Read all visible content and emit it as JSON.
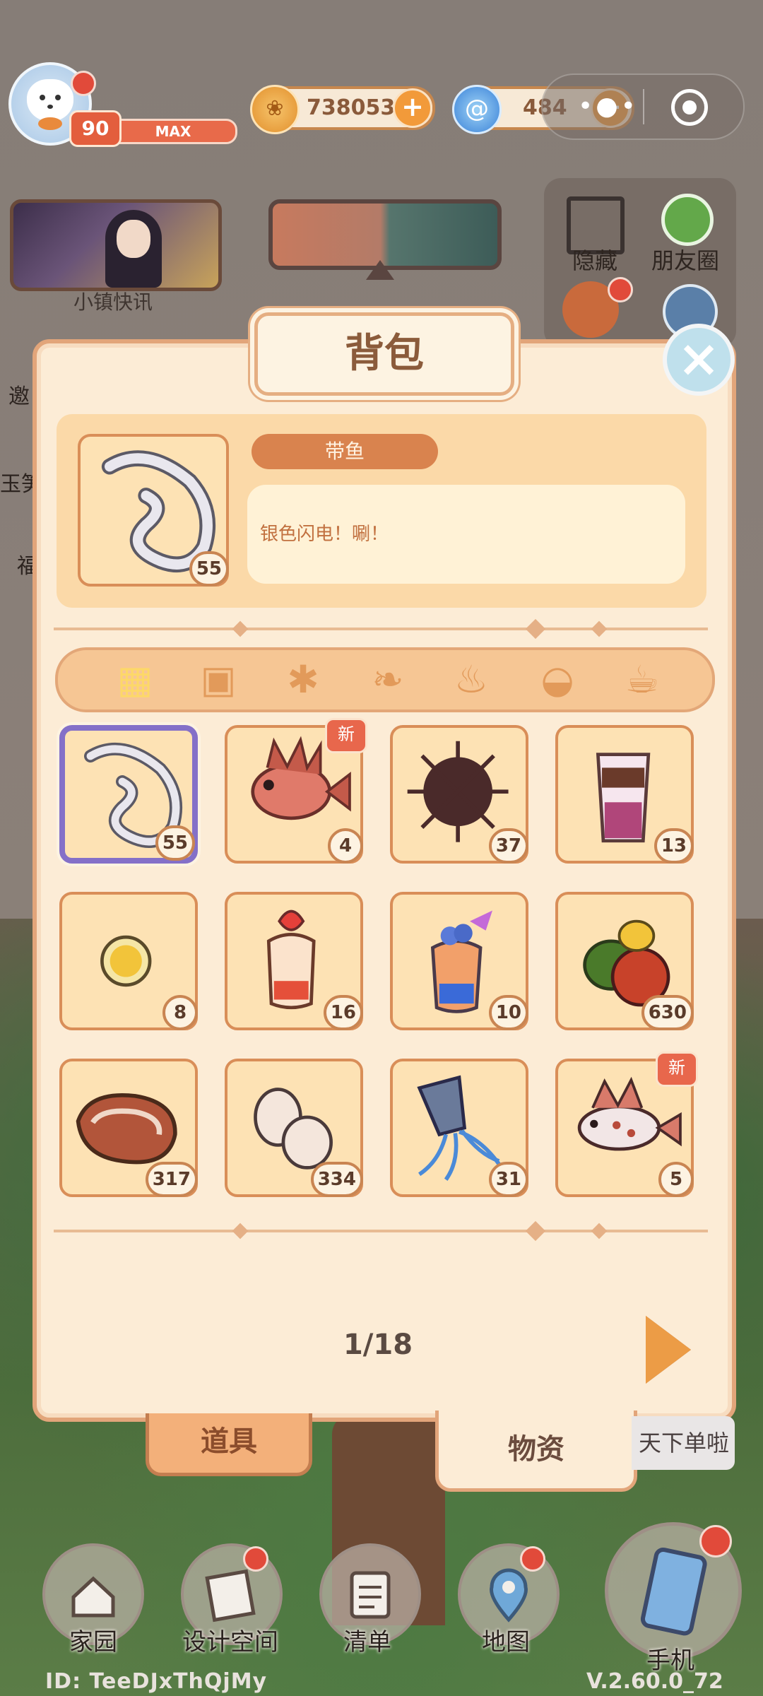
{
  "top_bar": {
    "level": "90",
    "level_status": "MAX",
    "coins": "738053",
    "gems": "484",
    "coin_plus": "+",
    "gem_plus": "+"
  },
  "hud": {
    "news_label": "小镇快讯",
    "hide_label": "隐藏",
    "friends_label": "朋友圈",
    "left_cut_1": "邀",
    "left_cut_2": "玉笋",
    "left_cut_3": "福"
  },
  "backpack": {
    "title": "背包",
    "close": "×",
    "selected_item": {
      "name": "带鱼",
      "description": "银色闪电！唰！",
      "count": "55"
    },
    "categories": [
      {
        "name": "all",
        "icon": "grid-icon"
      },
      {
        "name": "seeds",
        "icon": "seed-packet-icon"
      },
      {
        "name": "plants",
        "icon": "plant-icon"
      },
      {
        "name": "fish",
        "icon": "fish-icon"
      },
      {
        "name": "meat",
        "icon": "drumstick-icon"
      },
      {
        "name": "food",
        "icon": "bowl-icon"
      },
      {
        "name": "drinks",
        "icon": "cup-icon"
      }
    ],
    "new_tag": "新",
    "items": [
      {
        "count": "55",
        "icon": "hairtail-fish-icon",
        "is_new": false,
        "selected": true
      },
      {
        "count": "4",
        "icon": "red-scorpionfish-icon",
        "is_new": true,
        "selected": false
      },
      {
        "count": "37",
        "icon": "sea-urchin-icon",
        "is_new": false,
        "selected": false
      },
      {
        "count": "13",
        "icon": "layered-drink-icon",
        "is_new": false,
        "selected": false
      },
      {
        "count": "8",
        "icon": "lemon-slice-icon",
        "is_new": false,
        "selected": false
      },
      {
        "count": "16",
        "icon": "strawberry-parfait-icon",
        "is_new": false,
        "selected": false
      },
      {
        "count": "10",
        "icon": "blueberry-drink-icon",
        "is_new": false,
        "selected": false
      },
      {
        "count": "630",
        "icon": "bell-peppers-icon",
        "is_new": false,
        "selected": false
      },
      {
        "count": "317",
        "icon": "steak-icon",
        "is_new": false,
        "selected": false
      },
      {
        "count": "334",
        "icon": "eggs-icon",
        "is_new": false,
        "selected": false
      },
      {
        "count": "31",
        "icon": "squid-icon",
        "is_new": false,
        "selected": false
      },
      {
        "count": "5",
        "icon": "spotted-fish-icon",
        "is_new": true,
        "selected": false
      }
    ],
    "page": "1/18",
    "tabs": {
      "tools": "道具",
      "materials": "物资"
    },
    "notice_fragment": "天下单啦"
  },
  "bottom_nav": {
    "home": "家园",
    "design": "设计空间",
    "list": "清单",
    "map": "地图",
    "phone": "手机"
  },
  "footer": {
    "id": "ID: TeeDJxThQjMy",
    "version": "V.2.60.0_72"
  },
  "colors": {
    "modal_bg": "#fcecd6",
    "modal_border": "#e2a57a",
    "selected_border": "#8470c8",
    "new_tag": "#e8674c",
    "accent_orange": "#ec9c46"
  }
}
